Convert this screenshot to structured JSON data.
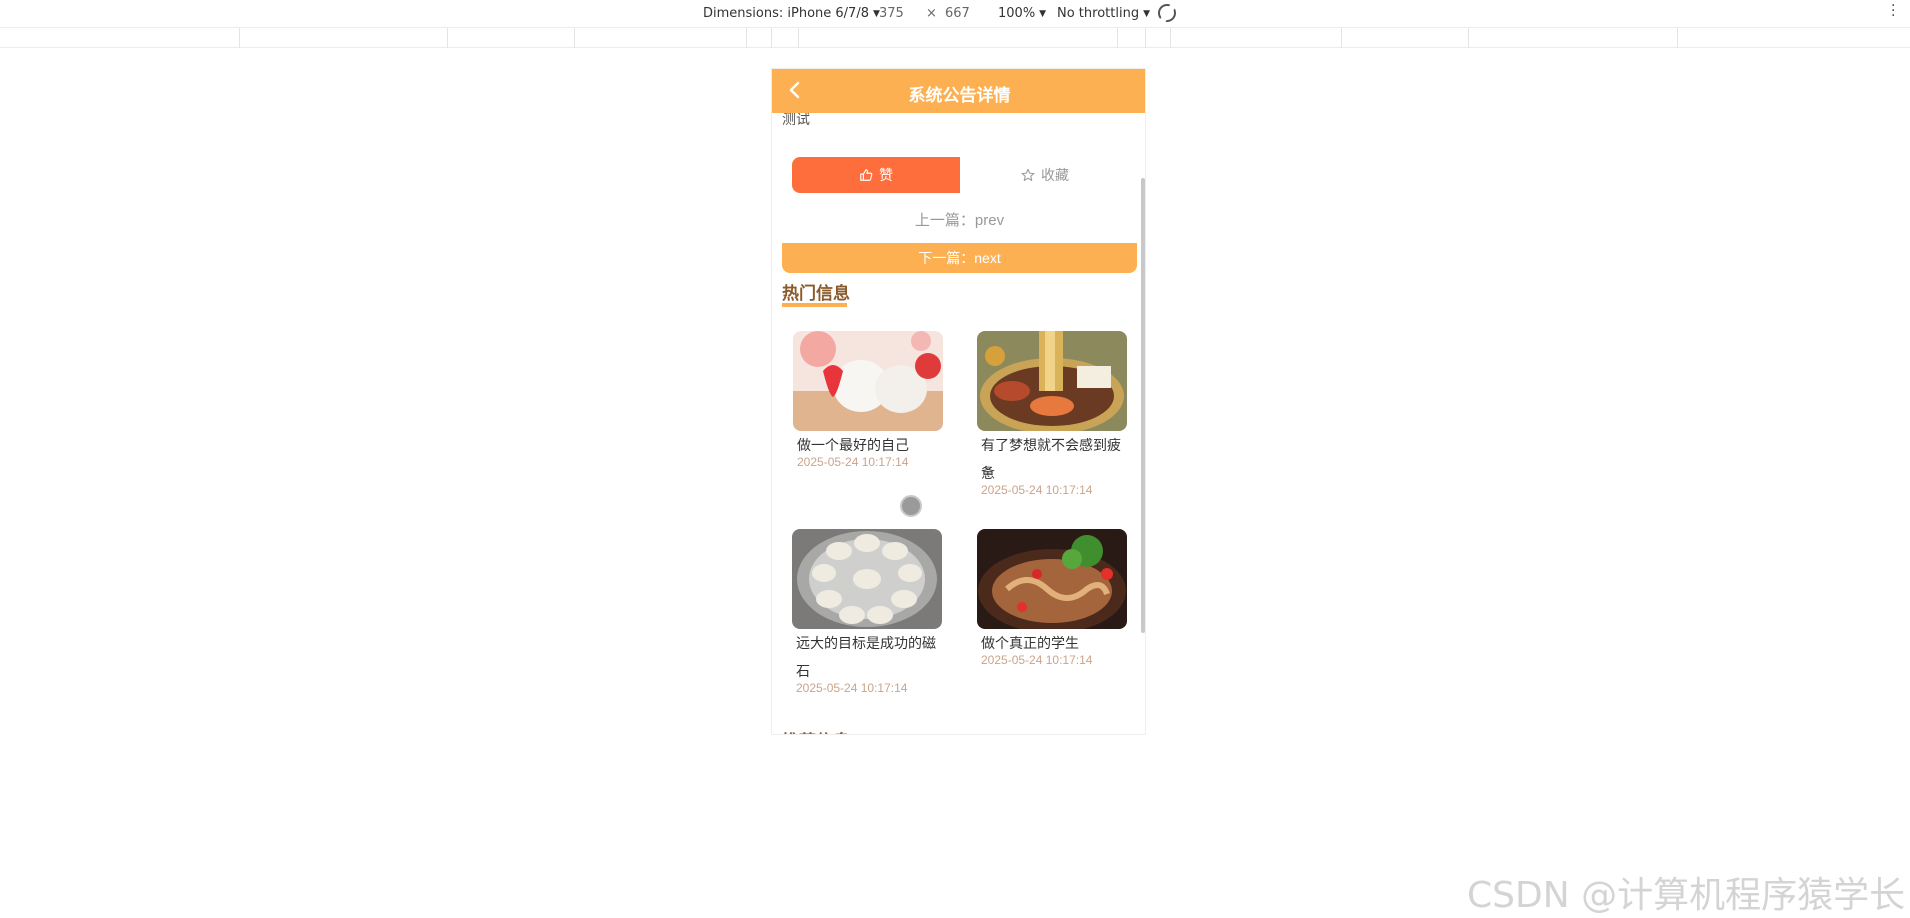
{
  "devtools": {
    "dimensions_label": "Dimensions: iPhone 6/7/8",
    "width": "375",
    "times": "×",
    "height": "667",
    "zoom": "100%",
    "throttling": "No throttling"
  },
  "nav": {
    "title": "系统公告详情"
  },
  "article": {
    "body": "测试"
  },
  "actions": {
    "like_label": "赞",
    "favorite_label": "收藏"
  },
  "pager": {
    "prev": "上一篇：prev",
    "next": "下一篇：next"
  },
  "hot": {
    "title": "热门信息",
    "items": [
      {
        "title": "做一个最好的自己",
        "time": "2025-05-24 10:17:14"
      },
      {
        "title": "有了梦想就不会感到疲惫",
        "time": "2025-05-24 10:17:14"
      },
      {
        "title": "远大的目标是成功的磁石",
        "time": "2025-05-24 10:17:14"
      },
      {
        "title": "做个真正的学生",
        "time": "2025-05-24 10:17:14"
      }
    ]
  },
  "recommend": {
    "title": "推荐信息"
  },
  "watermark": "CSDN @计算机程序猿学长",
  "colors": {
    "accent": "#fdb051",
    "like": "#fd6e3c",
    "section_title": "#8a5a2b",
    "time": "#c9a48a"
  }
}
